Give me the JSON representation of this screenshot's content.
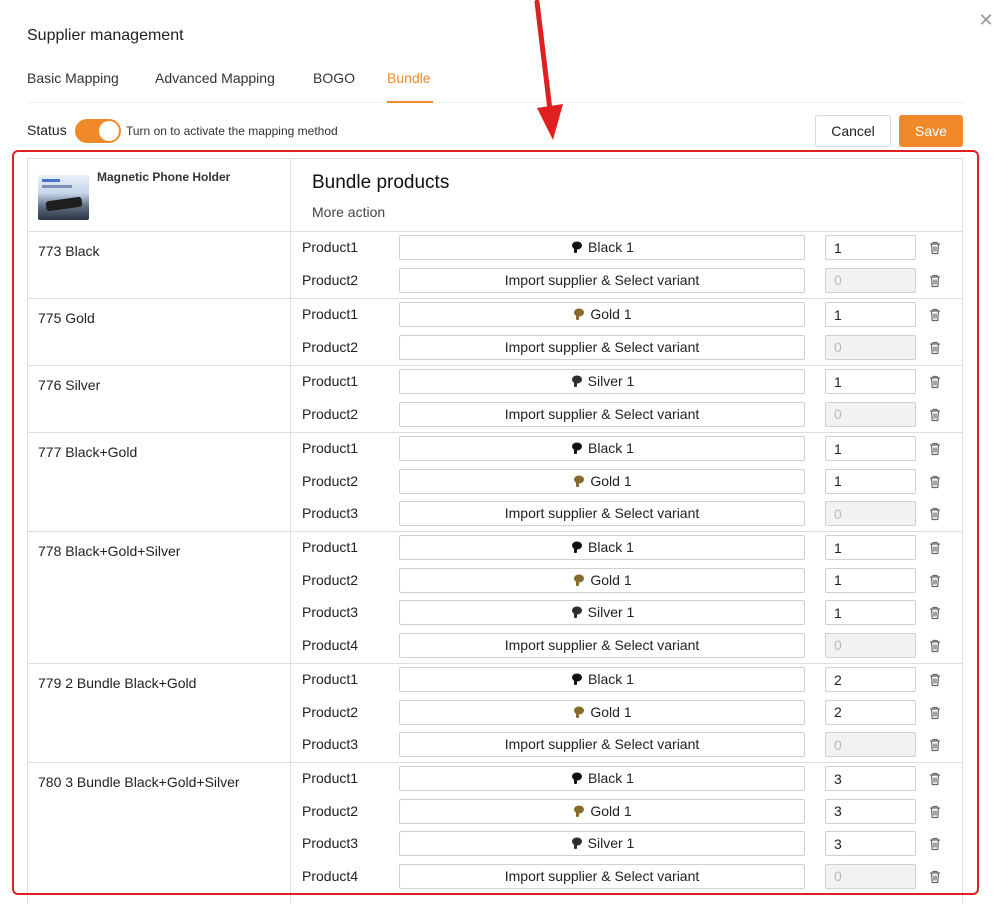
{
  "modal": {
    "title": "Supplier management"
  },
  "tabs": [
    {
      "label": "Basic Mapping"
    },
    {
      "label": "Advanced Mapping"
    },
    {
      "label": "BOGO"
    },
    {
      "label": "Bundle"
    }
  ],
  "status": {
    "label": "Status",
    "on": true,
    "hint": "Turn on to activate the mapping method"
  },
  "buttons": {
    "cancel": "Cancel",
    "save": "Save"
  },
  "product": {
    "name": "Magnetic Phone Holder"
  },
  "bundle": {
    "title": "Bundle products",
    "more_action": "More action"
  },
  "colors": {
    "accent": "#f0892a",
    "highlight": "#e02020",
    "black_pic": "#111111",
    "gold_pic": "#8a6a2a",
    "silver_pic": "#2e2e2e"
  },
  "rows": [
    {
      "variant": "773 Black",
      "products": [
        {
          "label": "Product1",
          "value": "Black 1",
          "icon": "black-holder-icon",
          "qty": "1",
          "disabled": false
        },
        {
          "label": "Product2",
          "value": "Import supplier & Select variant",
          "icon": null,
          "qty": "0",
          "disabled": true
        }
      ]
    },
    {
      "variant": "775 Gold",
      "products": [
        {
          "label": "Product1",
          "value": "Gold 1",
          "icon": "gold-holder-icon",
          "qty": "1",
          "disabled": false
        },
        {
          "label": "Product2",
          "value": "Import supplier & Select variant",
          "icon": null,
          "qty": "0",
          "disabled": true
        }
      ]
    },
    {
      "variant": "776 Silver",
      "products": [
        {
          "label": "Product1",
          "value": "Silver 1",
          "icon": "silver-holder-icon",
          "qty": "1",
          "disabled": false
        },
        {
          "label": "Product2",
          "value": "Import supplier & Select variant",
          "icon": null,
          "qty": "0",
          "disabled": true
        }
      ]
    },
    {
      "variant": "777 Black+Gold",
      "products": [
        {
          "label": "Product1",
          "value": "Black 1",
          "icon": "black-holder-icon",
          "qty": "1",
          "disabled": false
        },
        {
          "label": "Product2",
          "value": "Gold 1",
          "icon": "gold-holder-icon",
          "qty": "1",
          "disabled": false
        },
        {
          "label": "Product3",
          "value": "Import supplier & Select variant",
          "icon": null,
          "qty": "0",
          "disabled": true
        }
      ]
    },
    {
      "variant": "778 Black+Gold+Silver",
      "products": [
        {
          "label": "Product1",
          "value": "Black 1",
          "icon": "black-holder-icon",
          "qty": "1",
          "disabled": false
        },
        {
          "label": "Product2",
          "value": "Gold 1",
          "icon": "gold-holder-icon",
          "qty": "1",
          "disabled": false
        },
        {
          "label": "Product3",
          "value": "Silver 1",
          "icon": "silver-holder-icon",
          "qty": "1",
          "disabled": false
        },
        {
          "label": "Product4",
          "value": "Import supplier & Select variant",
          "icon": null,
          "qty": "0",
          "disabled": true
        }
      ]
    },
    {
      "variant": "779 2 Bundle Black+Gold",
      "products": [
        {
          "label": "Product1",
          "value": "Black 1",
          "icon": "black-holder-icon",
          "qty": "2",
          "disabled": false
        },
        {
          "label": "Product2",
          "value": "Gold 1",
          "icon": "gold-holder-icon",
          "qty": "2",
          "disabled": false
        },
        {
          "label": "Product3",
          "value": "Import supplier & Select variant",
          "icon": null,
          "qty": "0",
          "disabled": true
        }
      ]
    },
    {
      "variant": "780 3 Bundle Black+Gold+Silver",
      "products": [
        {
          "label": "Product1",
          "value": "Black 1",
          "icon": "black-holder-icon",
          "qty": "3",
          "disabled": false
        },
        {
          "label": "Product2",
          "value": "Gold 1",
          "icon": "gold-holder-icon",
          "qty": "3",
          "disabled": false
        },
        {
          "label": "Product3",
          "value": "Silver 1",
          "icon": "silver-holder-icon",
          "qty": "3",
          "disabled": false
        },
        {
          "label": "Product4",
          "value": "Import supplier & Select variant",
          "icon": null,
          "qty": "0",
          "disabled": true
        }
      ]
    }
  ]
}
